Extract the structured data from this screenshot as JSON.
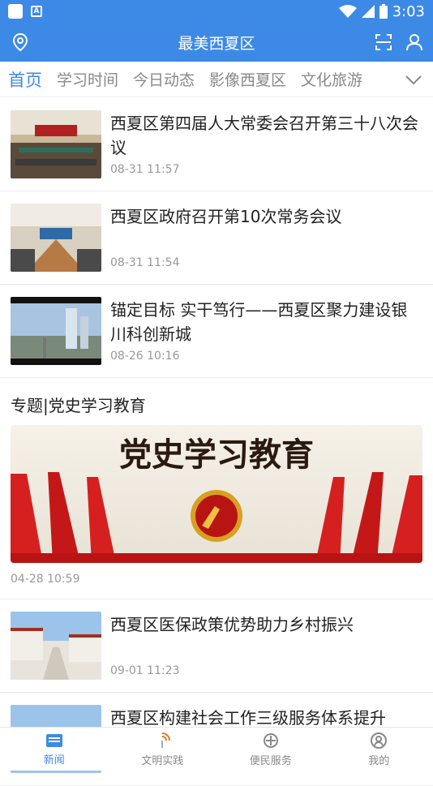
{
  "status": {
    "time": "3:03"
  },
  "header": {
    "title": "最美西夏区"
  },
  "tabs": [
    {
      "label": "首页"
    },
    {
      "label": "学习时间"
    },
    {
      "label": "今日动态"
    },
    {
      "label": "影像西夏区"
    },
    {
      "label": "文化旅游"
    }
  ],
  "news": [
    {
      "title": "西夏区第四届人大常委会召开第三十八次会议",
      "time": "08-31 11:57"
    },
    {
      "title": "西夏区政府召开第10次常务会议",
      "time": "08-31 11:54"
    },
    {
      "title": "锚定目标 实干笃行——西夏区聚力建设银川科创新城",
      "time": "08-26 10:16"
    }
  ],
  "special": {
    "title": "专题|党史学习教育",
    "banner_text": "党史学习教育",
    "time": "04-28 10:59"
  },
  "news2": [
    {
      "title": "西夏区医保政策优势助力乡村振兴",
      "time": "09-01 11:23"
    },
    {
      "title": "西夏区构建社会工作三级服务体系提升",
      "time": ""
    }
  ],
  "bottom_nav": [
    {
      "label": "新闻",
      "icon": "news-icon"
    },
    {
      "label": "文明实践",
      "icon": "civilization-icon"
    },
    {
      "label": "便民服务",
      "icon": "service-icon"
    },
    {
      "label": "我的",
      "icon": "profile-icon"
    }
  ],
  "colors": {
    "primary": "#3c8ae6"
  }
}
